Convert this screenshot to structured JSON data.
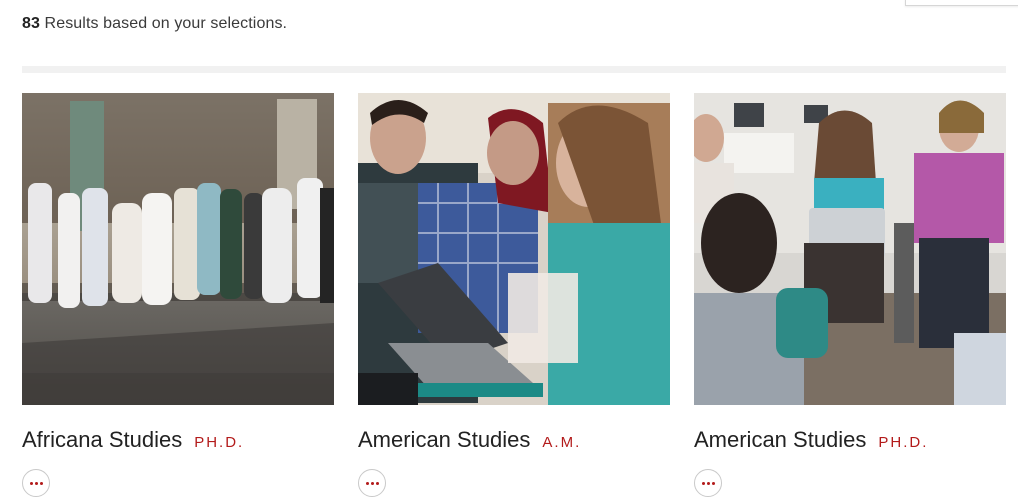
{
  "results": {
    "count": "83",
    "text": "Results based on your selections."
  },
  "programs": [
    {
      "name": "Africana Studies",
      "degree": "PH.D.",
      "photo": "procession-on-walkway-photo"
    },
    {
      "name": "American Studies",
      "degree": "A.M.",
      "photo": "students-with-laptops-photo"
    },
    {
      "name": "American Studies",
      "degree": "PH.D.",
      "photo": "seminar-discussion-photo"
    }
  ],
  "colors": {
    "accent": "#b31b1b",
    "divider": "#f1f1f1"
  }
}
